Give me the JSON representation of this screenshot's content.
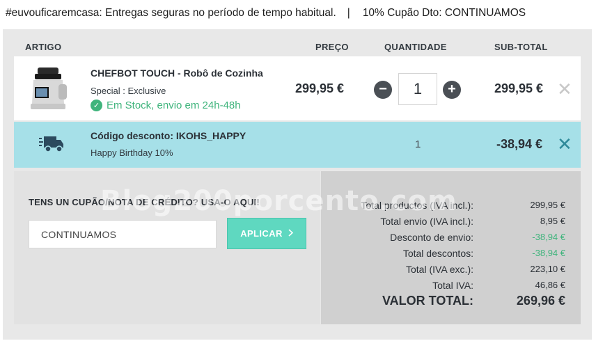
{
  "banner": {
    "promo": "#euvouficaremcasa: Entregas seguras no período de tempo habitual.",
    "separator": "|",
    "coupon": "10% Cupão Dto: CONTINUAMOS"
  },
  "table": {
    "headers": {
      "artigo": "ARTIGO",
      "preco": "PREÇO",
      "quantidade": "QUANTIDADE",
      "subtotal": "SUB-TOTAL"
    }
  },
  "product": {
    "name": "CHEFBOT TOUCH - Robô de Cozinha",
    "variant": "Special : Exclusive",
    "stock": "Em Stock, envio em 24h-48h",
    "price": "299,95 €",
    "quantity": "1",
    "subtotal": "299,95 €",
    "icons": {
      "decrement": "minus-circle-icon",
      "increment": "plus-circle-icon",
      "remove": "close-icon",
      "stock": "check-circle-icon"
    }
  },
  "discount": {
    "name": "Código desconto: IKOHS_HAPPY",
    "description": "Happy Birthday 10%",
    "quantity": "1",
    "subtotal": "-38,94 €",
    "icons": {
      "type": "delivery-truck-icon",
      "remove": "close-icon"
    }
  },
  "watermark": "Blog200porcento.com",
  "coupon": {
    "title": "TENS UN CUPÃO/NOTA DE CRÉDITO? USA-O AQUI!",
    "input_value": "CONTINUAMOS",
    "apply_label": "APLICAR",
    "apply_icon": "chevron-right-icon"
  },
  "totals": [
    {
      "label": "Total productos (IVA incl.):",
      "value": "299,95 €",
      "style": "normal"
    },
    {
      "label": "Total envio (IVA incl.):",
      "value": "8,95 €",
      "style": "normal"
    },
    {
      "label": "Desconto de envio:",
      "value": "-38,94 €",
      "style": "green"
    },
    {
      "label": "Total descontos:",
      "value": "-38,94 €",
      "style": "green"
    },
    {
      "label": "Total (IVA exc.):",
      "value": "223,10 €",
      "style": "normal"
    },
    {
      "label": "Total IVA:",
      "value": "46,86 €",
      "style": "normal"
    },
    {
      "label": "VALOR TOTAL:",
      "value": "269,96 €",
      "style": "grand"
    }
  ],
  "colors": {
    "accent_teal": "#5fd8c0",
    "discount_row": "#a6e0e8",
    "stock_green": "#3fb47c",
    "panel_bg": "#e8e8e8"
  }
}
